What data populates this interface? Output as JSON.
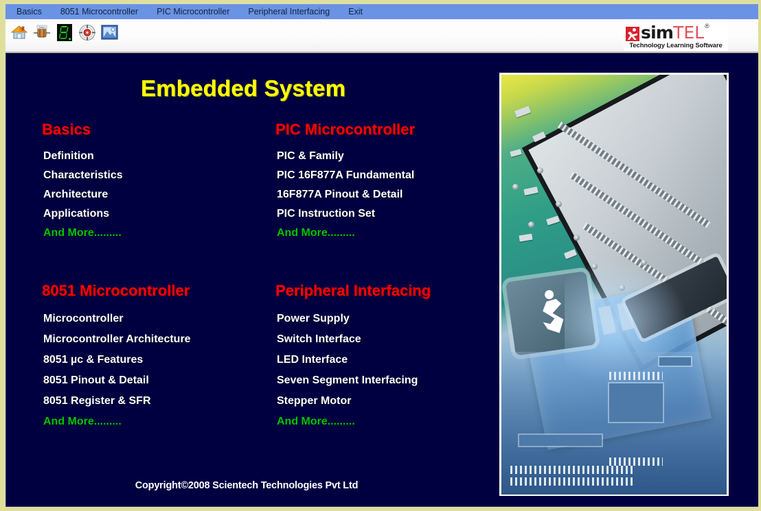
{
  "menu": {
    "items": [
      {
        "label": "Basics",
        "name": "menu-basics"
      },
      {
        "label": "8051 Microcontroller",
        "name": "menu-8051-microcontroller"
      },
      {
        "label": "PIC Microcontroller",
        "name": "menu-pic-microcontroller"
      },
      {
        "label": "Peripheral Interfacing",
        "name": "menu-peripheral-interfacing"
      },
      {
        "label": "Exit",
        "name": "menu-exit"
      }
    ]
  },
  "toolbar": {
    "buttons": [
      {
        "icon": "home-icon",
        "title": "Home"
      },
      {
        "icon": "component-icon",
        "title": "Components"
      },
      {
        "icon": "seven-segment-display-icon",
        "title": "Seven Segment"
      },
      {
        "icon": "meter-icon",
        "title": "Meter"
      },
      {
        "icon": "image-icon",
        "title": "Image"
      }
    ]
  },
  "logo": {
    "sim": "sim",
    "tel": "TEL",
    "registered": "®",
    "tagline": "Technology Learning  Software"
  },
  "main": {
    "title": "Embedded System",
    "columns": [
      {
        "heading": "Basics",
        "items": [
          "Definition",
          "Characteristics",
          "Architecture",
          "Applications"
        ],
        "more": "And More........."
      },
      {
        "heading": "PIC Microcontroller",
        "items": [
          "PIC & Family",
          "PIC 16F877A Fundamental",
          "16F877A Pinout & Detail",
          "PIC Instruction Set"
        ],
        "more": "And More........."
      },
      {
        "heading": "8051 Microcontroller",
        "items": [
          "Microcontroller",
          "Microcontroller Architecture",
          "8051 µc & Features",
          "8051 Pinout & Detail",
          "8051 Register & SFR"
        ],
        "more": "And More........."
      },
      {
        "heading": "Peripheral Interfacing",
        "items": [
          "Power Supply",
          "Switch Interface",
          "LED Interface",
          "Seven Segment Interfacing",
          "Stepper Motor"
        ],
        "more": "And More........."
      }
    ],
    "hero_image_alt": "circuit-board-photo",
    "copyright": "Copyright©2008 Scientech Technologies Pvt Ltd"
  },
  "colors": {
    "menu_bar": "#6a93e3",
    "stage_background": "#000040",
    "title": "#ffff00",
    "heading": "#ff0000",
    "item": "#ffffff",
    "more": "#00c400",
    "window_frame": "#dfdf99"
  }
}
